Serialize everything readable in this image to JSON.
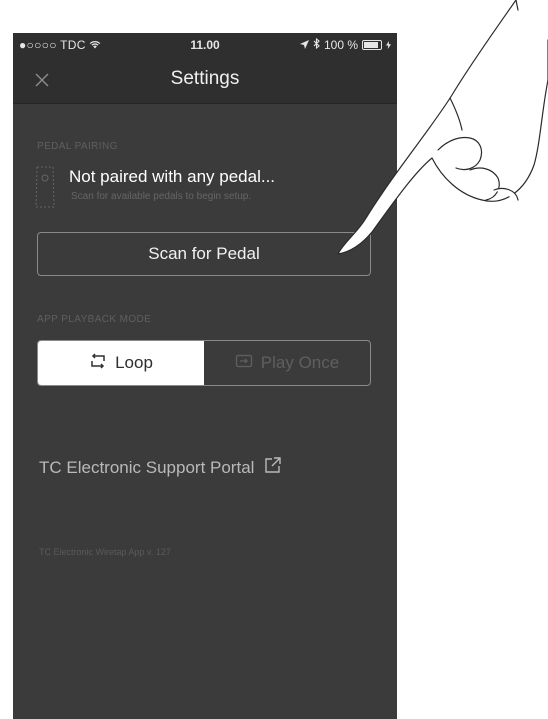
{
  "status_bar": {
    "carrier": "●○○○○ TDC",
    "time": "11.00",
    "battery_percent": "100 %",
    "battery_level": 1.0
  },
  "nav": {
    "title": "Settings"
  },
  "pedal_pairing": {
    "section_label": "PEDAL PAIRING",
    "title": "Not paired with any pedal...",
    "subtitle": "Scan for available pedals to begin setup.",
    "scan_button_label": "Scan for Pedal"
  },
  "playback_mode": {
    "section_label": "APP PLAYBACK MODE",
    "options": [
      {
        "label": "Loop",
        "selected": true
      },
      {
        "label": "Play Once",
        "selected": false
      }
    ]
  },
  "support": {
    "link_label": "TC Electronic Support Portal"
  },
  "version_text": "TC Electronic Wiretap App v. 127",
  "colors": {
    "background": "#3b3b3b",
    "bar": "#2f2f2f",
    "active_segment": "#ffffff"
  }
}
